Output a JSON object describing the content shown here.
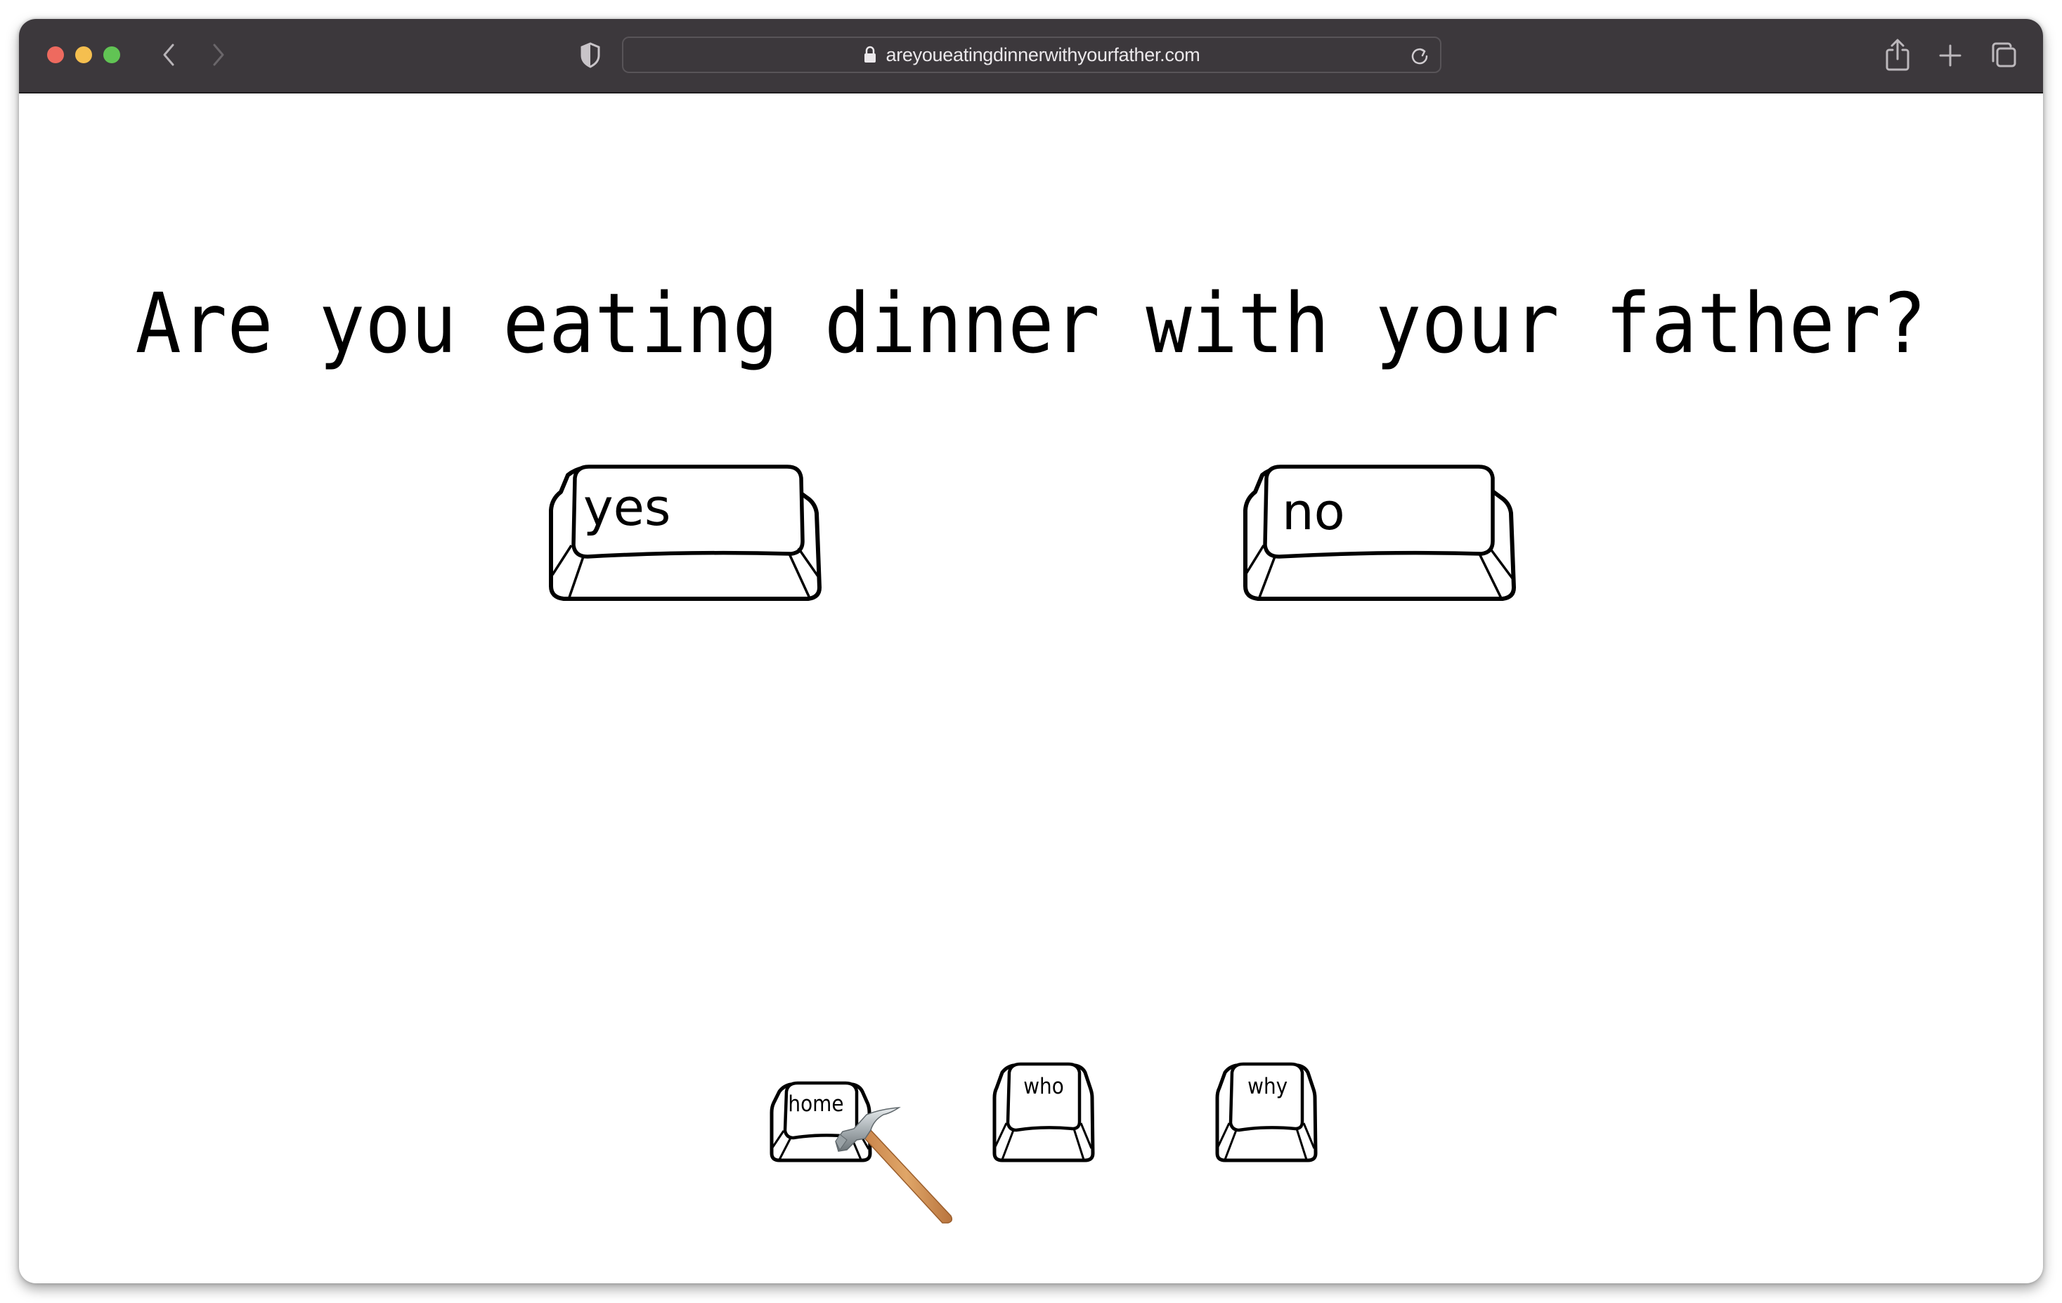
{
  "browser": {
    "url": "areyoueatingdinnerwithyourfather.com",
    "traffic_lights": {
      "close": "#ee6a5f",
      "minimize": "#f5bf4f",
      "zoom": "#61c454"
    },
    "toolbar_icons": [
      "back-chevron-icon",
      "forward-chevron-icon",
      "privacy-shield-icon",
      "lock-icon",
      "reload-icon",
      "share-icon",
      "new-tab-plus-icon",
      "tab-overview-icon"
    ],
    "titlebar_color": "#3c383c"
  },
  "page": {
    "heading": "Are you eating dinner with your father?",
    "answers": {
      "yes": "yes",
      "no": "no"
    },
    "nav": {
      "home": "home",
      "who": "who",
      "why": "why"
    },
    "cursor": "hammer-cursor-icon"
  }
}
